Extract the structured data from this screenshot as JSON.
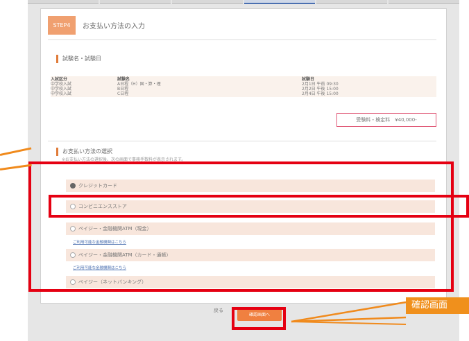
{
  "step": {
    "badge": "STEP4",
    "title": "お支払い方法の入力"
  },
  "exam_section": {
    "heading": "試験名・試験日"
  },
  "exam_table": {
    "headers": [
      "入試区分",
      "試験名",
      "試験日"
    ],
    "rows": [
      [
        "中学校入試",
        "A日程（H）国・算・理",
        "2月1日 午前 09:30"
      ],
      [
        "中学校入試",
        "B日程",
        "2月2日 午後 15:00"
      ],
      [
        "中学校入試",
        "C日程",
        "2月4日 午後 15:00"
      ]
    ]
  },
  "fee": {
    "label": "受験料・検定料　¥40,000-"
  },
  "payment": {
    "heading": "お支払い方法の選択",
    "note": "※お支払い方法の選択後、次の画面で事務手数料が表示されます。",
    "options": [
      {
        "label": "クレジットカード",
        "selected": true
      },
      {
        "label": "コンビニエンスストア",
        "selected": false
      },
      {
        "label": "ペイジー・金融機関ATM（現金）",
        "selected": false,
        "link": "ご利用可能な金融機関はこちら"
      },
      {
        "label": "ペイジー・金融機関ATM（カード・通帳）",
        "selected": false,
        "link": "ご利用可能な金融機関はこちら"
      },
      {
        "label": "ペイジー（ネットバンキング）",
        "selected": false
      }
    ]
  },
  "buttons": {
    "back": "戻る",
    "next": "確認画面へ"
  },
  "annotation": {
    "callout_text": "確認画面",
    "highlight_color": "#e50012",
    "callout_color": "#f0901c"
  }
}
